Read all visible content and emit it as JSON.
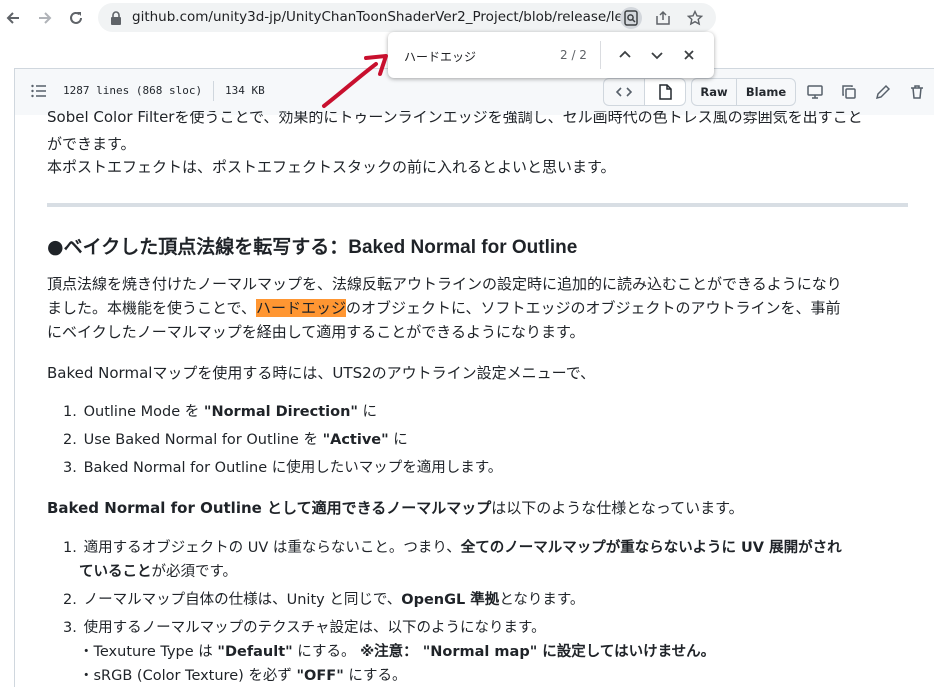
{
  "browser": {
    "url": "github.com/unity3d-jp/UnityChanToonShaderVer2_Project/blob/release/leg..."
  },
  "find_bar": {
    "query": "ハードエッジ",
    "count": "2 / 2"
  },
  "file_header": {
    "lines_info": "1287 lines (868 sloc)",
    "size": "134 KB",
    "raw_label": "Raw",
    "blame_label": "Blame"
  },
  "content": {
    "intro_line1": "Sobel Color Filterを使うことで、効果的にトゥーンラインエッジを強調し、セル画時代の色トレス風の雰囲気を出すこと",
    "intro_line2": "ができます。",
    "intro_line3": "本ポストエフェクトは、ポストエフェクトスタックの前に入れるとよいと思います。",
    "heading_bullet": "●",
    "heading_jp": "ベイクした頂点法線を転写する：",
    "heading_en": "Baked Normal for Outline",
    "para1_line1": "頂点法線を焼き付けたノーマルマップを、法線反転アウトラインの設定時に追加的に読み込むことができるようになり",
    "para1_line2_a": "ました。本機能を使うことで、",
    "para1_line2_hl": "ハードエッジ",
    "para1_line2_b": "のオブジェクトに、ソフトエッジのオブジェクトのアウトラインを、事前",
    "para1_line3": "にベイクしたノーマルマップを経由して適用することができるようになります。",
    "para2": "Baked Normalマップを使用する時には、UTS2のアウトライン設定メニューで、",
    "list1": [
      {
        "num": "1.",
        "a": "Outline Mode を ",
        "b": "\"Normal Direction\"",
        "c": " に"
      },
      {
        "num": "2.",
        "a": "Use Baked Normal for Outline を ",
        "b": "\"Active\"",
        "c": " に"
      },
      {
        "num": "3.",
        "a": "Baked Normal for Outline に使用したいマップを適用します。",
        "b": "",
        "c": ""
      }
    ],
    "para3_bold": "Baked Normal for Outline として適用できるノーマルマップ",
    "para3_rest": "は以下のような仕様となっています。",
    "list2_item1_a": "適用するオブジェクトの UV は重ならないこと。つまり、",
    "list2_item1_b": "全てのノーマルマップが重ならないように UV 展開がされ",
    "list2_item1_c": "ていること",
    "list2_item1_d": "が必須です。",
    "list2_item2_a": "ノーマルマップ自体の仕様は、Unity と同じで、",
    "list2_item2_b": "OpenGL 準拠",
    "list2_item2_c": "となります。",
    "list2_item3": "使用するノーマルマップのテクスチャ設定は、以下のようになります。",
    "sub1_a": "・Texuture Type は ",
    "sub1_b": "\"Default\"",
    "sub1_c": " にする。 ",
    "sub1_d": "※注意： \"Normal map\" に設定してはいけません。",
    "sub2_a": "・sRGB (Color Texture) を必ず ",
    "sub2_b": "\"OFF\"",
    "sub2_c": " にする。",
    "n1": "1.",
    "n2": "2.",
    "n3": "3."
  },
  "colors": {
    "find_highlight": "#ff9632",
    "annotation_arrow": "#c8102e"
  }
}
